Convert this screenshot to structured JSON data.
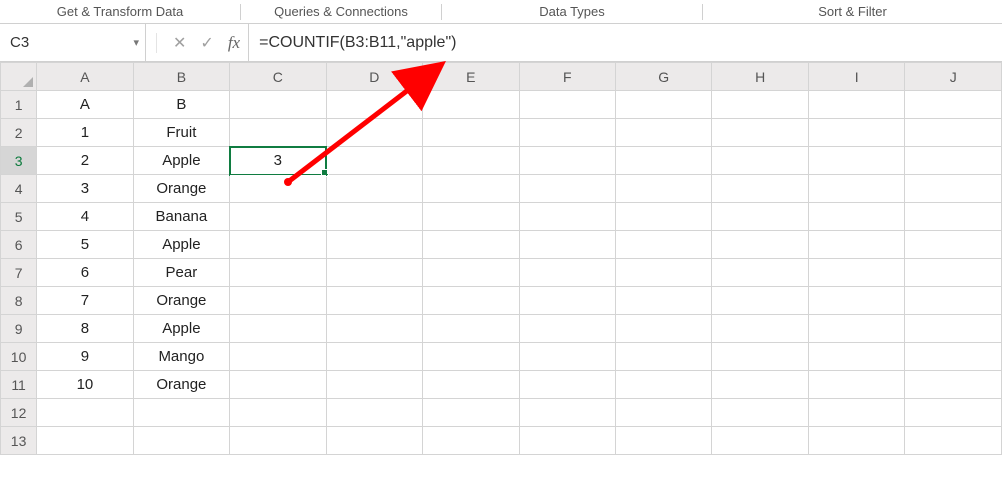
{
  "ribbon_groups": {
    "g1": "Get & Transform Data",
    "g2": "Queries & Connections",
    "g3": "Data Types",
    "g4": "Sort & Filter"
  },
  "name_box": {
    "value": "C3"
  },
  "formula_bar": {
    "fx_label": "fx",
    "formula": "=COUNTIF(B3:B11,\"apple\")"
  },
  "columns": [
    "A",
    "B",
    "C",
    "D",
    "E",
    "F",
    "G",
    "H",
    "I",
    "J"
  ],
  "row_numbers": [
    "1",
    "2",
    "3",
    "4",
    "5",
    "6",
    "7",
    "8",
    "9",
    "10",
    "11",
    "12",
    "13"
  ],
  "selected_row": "3",
  "cells": {
    "r1": {
      "A": "A",
      "B": "B"
    },
    "r2": {
      "A": "1",
      "B": "Fruit"
    },
    "r3": {
      "A": "2",
      "B": "Apple",
      "C": "3"
    },
    "r4": {
      "A": "3",
      "B": "Orange"
    },
    "r5": {
      "A": "4",
      "B": "Banana"
    },
    "r6": {
      "A": "5",
      "B": "Apple"
    },
    "r7": {
      "A": "6",
      "B": "Pear"
    },
    "r8": {
      "A": "7",
      "B": "Orange"
    },
    "r9": {
      "A": "8",
      "B": "Apple"
    },
    "r10": {
      "A": "9",
      "B": "Mango"
    },
    "r11": {
      "A": "10",
      "B": "Orange"
    }
  }
}
